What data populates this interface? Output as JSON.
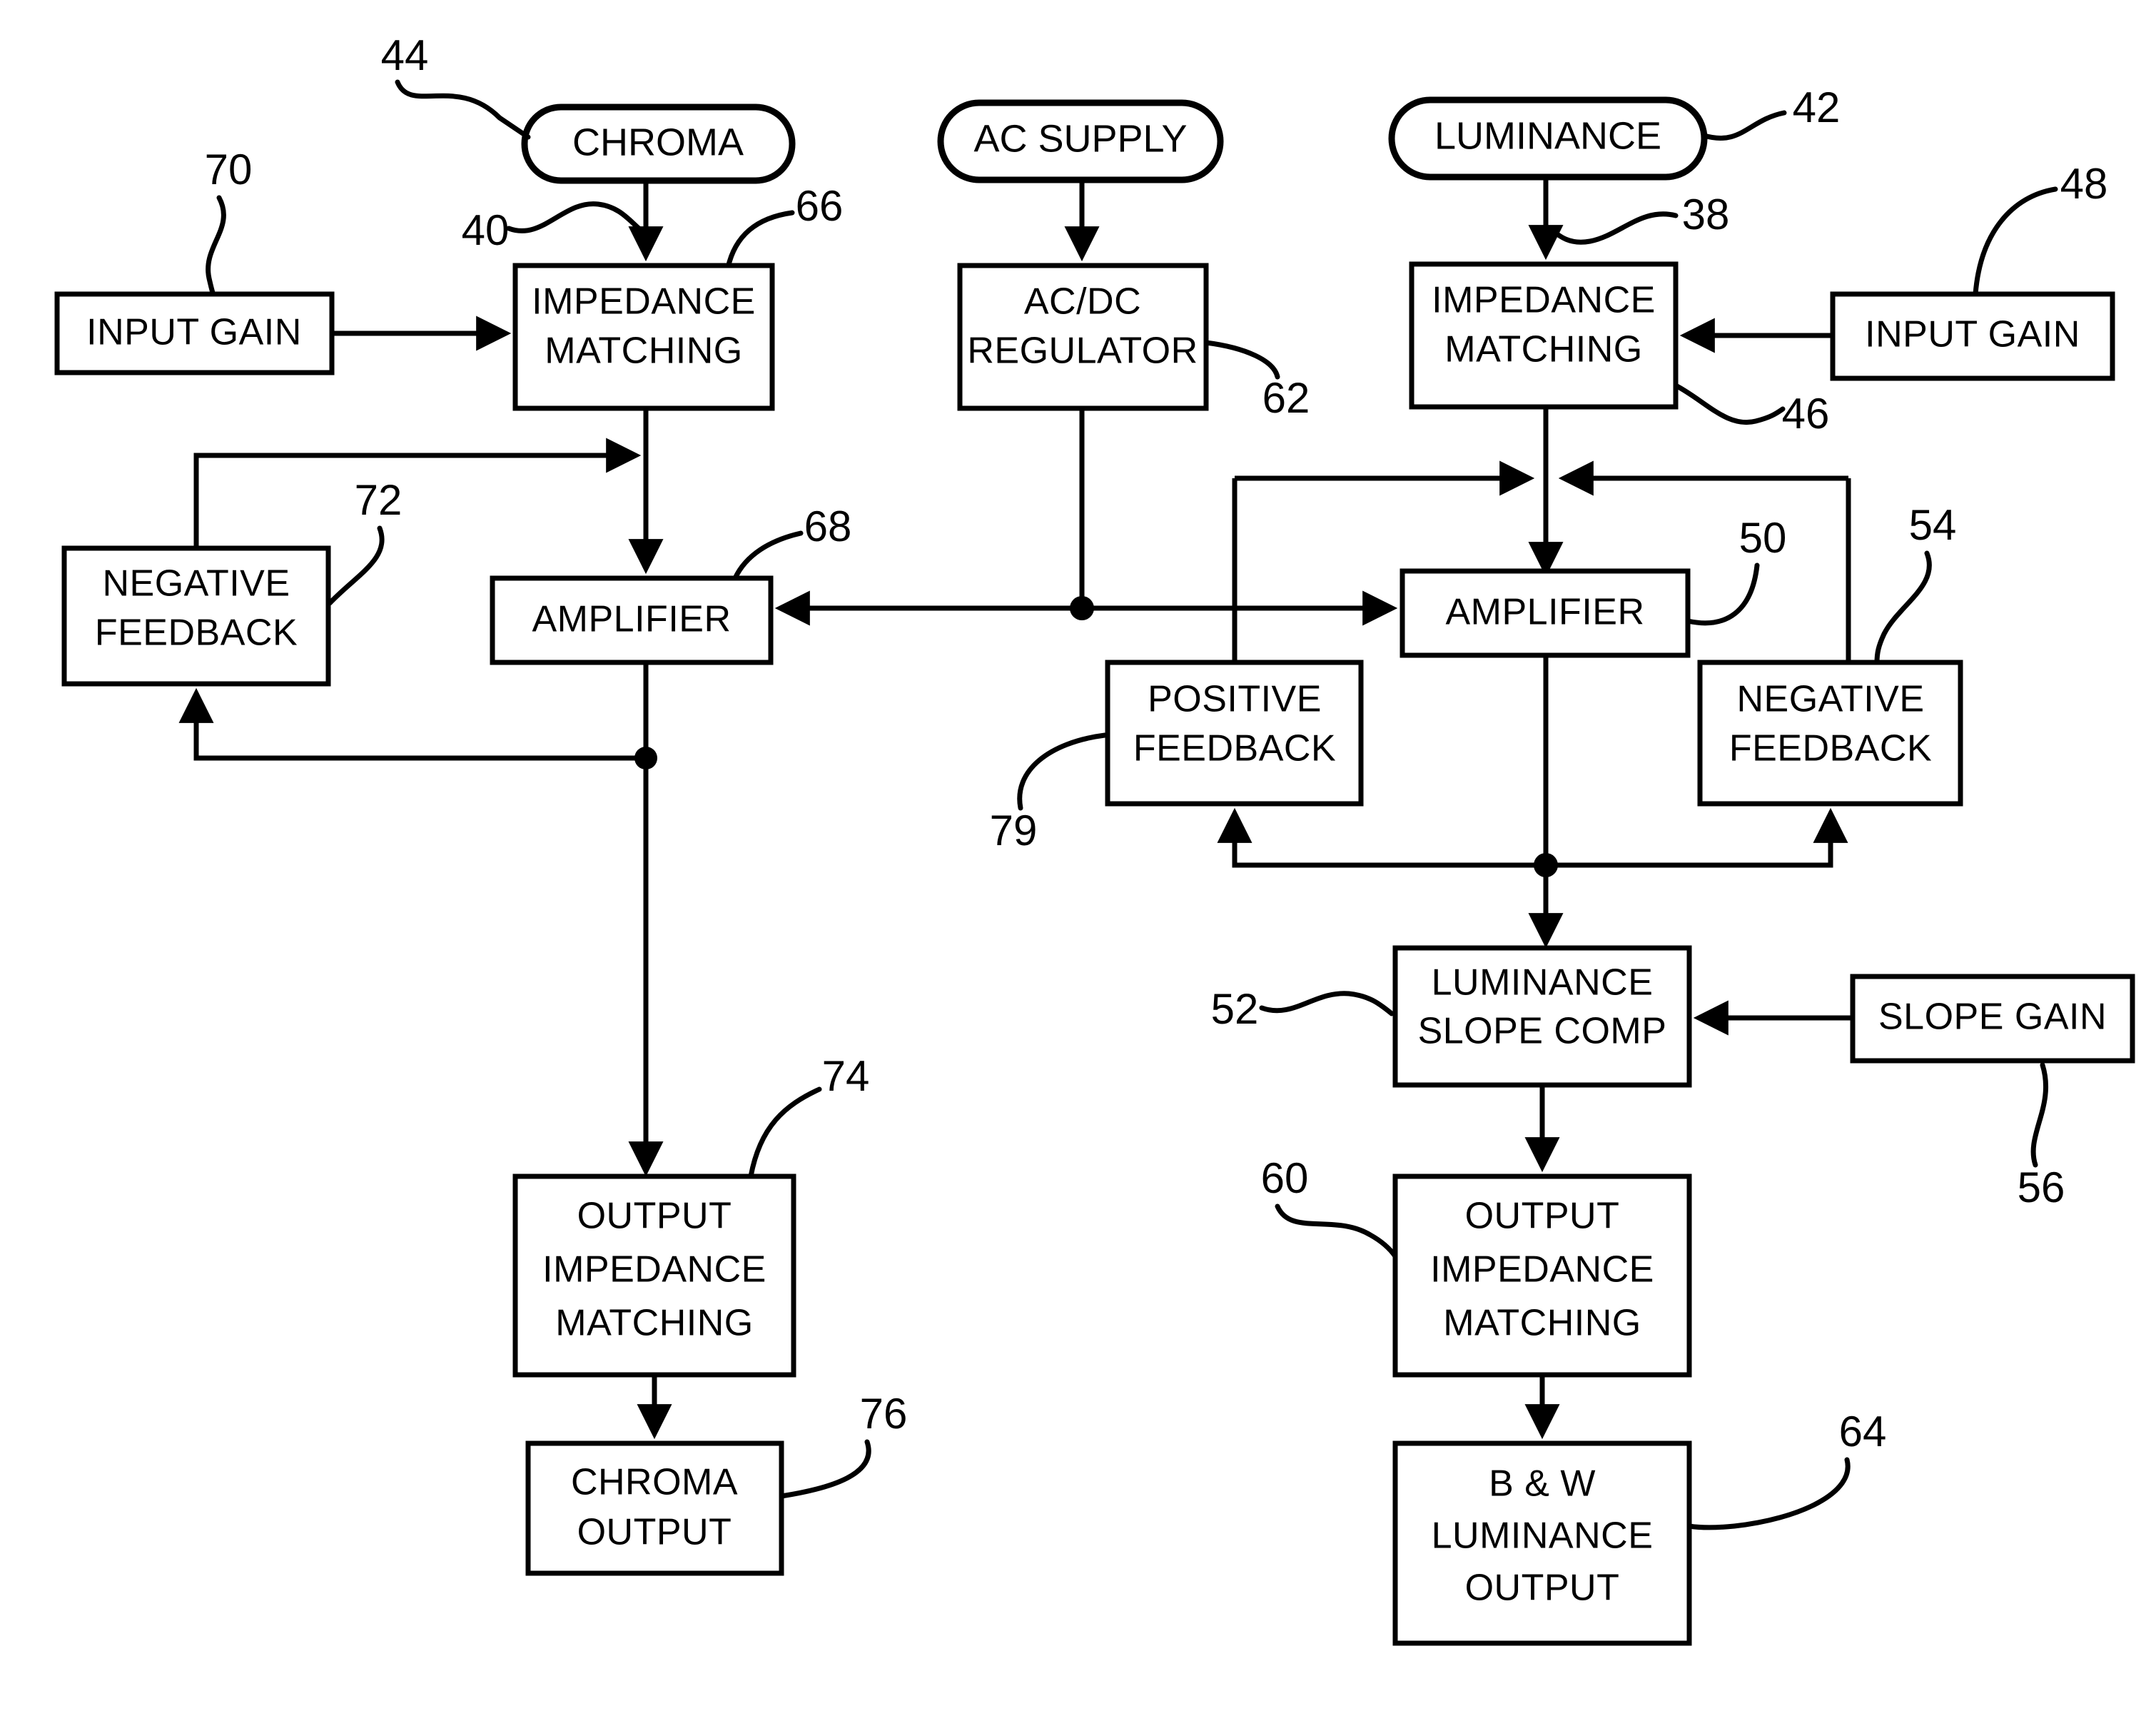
{
  "figure": {
    "type": "patent-block-diagram",
    "background_color": "#ffffff",
    "line_color": "#000000"
  },
  "nodes": {
    "chroma_source": {
      "label": "CHROMA",
      "shape": "rounded"
    },
    "ac_supply": {
      "label": "AC SUPPLY",
      "shape": "rounded"
    },
    "luminance_source": {
      "label": "LUMINANCE",
      "shape": "rounded"
    },
    "input_gain_left": {
      "label": "INPUT GAIN",
      "shape": "rect"
    },
    "input_gain_right": {
      "label": "INPUT GAIN",
      "shape": "rect"
    },
    "impedance_matching_left_l1": {
      "label": "IMPEDANCE"
    },
    "impedance_matching_left_l2": {
      "label": "MATCHING"
    },
    "impedance_matching_right_l1": {
      "label": "IMPEDANCE"
    },
    "impedance_matching_right_l2": {
      "label": "MATCHING"
    },
    "acdc_regulator_l1": {
      "label": "AC/DC"
    },
    "acdc_regulator_l2": {
      "label": "REGULATOR"
    },
    "amplifier_left": {
      "label": "AMPLIFIER",
      "shape": "rect"
    },
    "amplifier_right": {
      "label": "AMPLIFIER",
      "shape": "rect"
    },
    "negative_feedback_left_l1": {
      "label": "NEGATIVE"
    },
    "negative_feedback_left_l2": {
      "label": "FEEDBACK"
    },
    "negative_feedback_right_l1": {
      "label": "NEGATIVE"
    },
    "negative_feedback_right_l2": {
      "label": "FEEDBACK"
    },
    "positive_feedback_l1": {
      "label": "POSITIVE"
    },
    "positive_feedback_l2": {
      "label": "FEEDBACK"
    },
    "luminance_slope_comp_l1": {
      "label": "LUMINANCE"
    },
    "luminance_slope_comp_l2": {
      "label": "SLOPE COMP"
    },
    "slope_gain": {
      "label": "SLOPE GAIN",
      "shape": "rect"
    },
    "output_impedance_left_l1": {
      "label": "OUTPUT"
    },
    "output_impedance_left_l2": {
      "label": "IMPEDANCE"
    },
    "output_impedance_left_l3": {
      "label": "MATCHING"
    },
    "output_impedance_right_l1": {
      "label": "OUTPUT"
    },
    "output_impedance_right_l2": {
      "label": "IMPEDANCE"
    },
    "output_impedance_right_l3": {
      "label": "MATCHING"
    },
    "chroma_output_l1": {
      "label": "CHROMA"
    },
    "chroma_output_l2": {
      "label": "OUTPUT"
    },
    "bw_luminance_output_l1": {
      "label": "B & W"
    },
    "bw_luminance_output_l2": {
      "label": "LUMINANCE"
    },
    "bw_luminance_output_l3": {
      "label": "OUTPUT"
    }
  },
  "reference_numerals": {
    "n38": "38",
    "n40": "40",
    "n42": "42",
    "n44": "44",
    "n46": "46",
    "n48": "48",
    "n50": "50",
    "n52": "52",
    "n54": "54",
    "n56": "56",
    "n60": "60",
    "n62": "62",
    "n64": "64",
    "n66": "66",
    "n68": "68",
    "n70": "70",
    "n72": "72",
    "n74": "74",
    "n76": "76",
    "n79": "79"
  }
}
